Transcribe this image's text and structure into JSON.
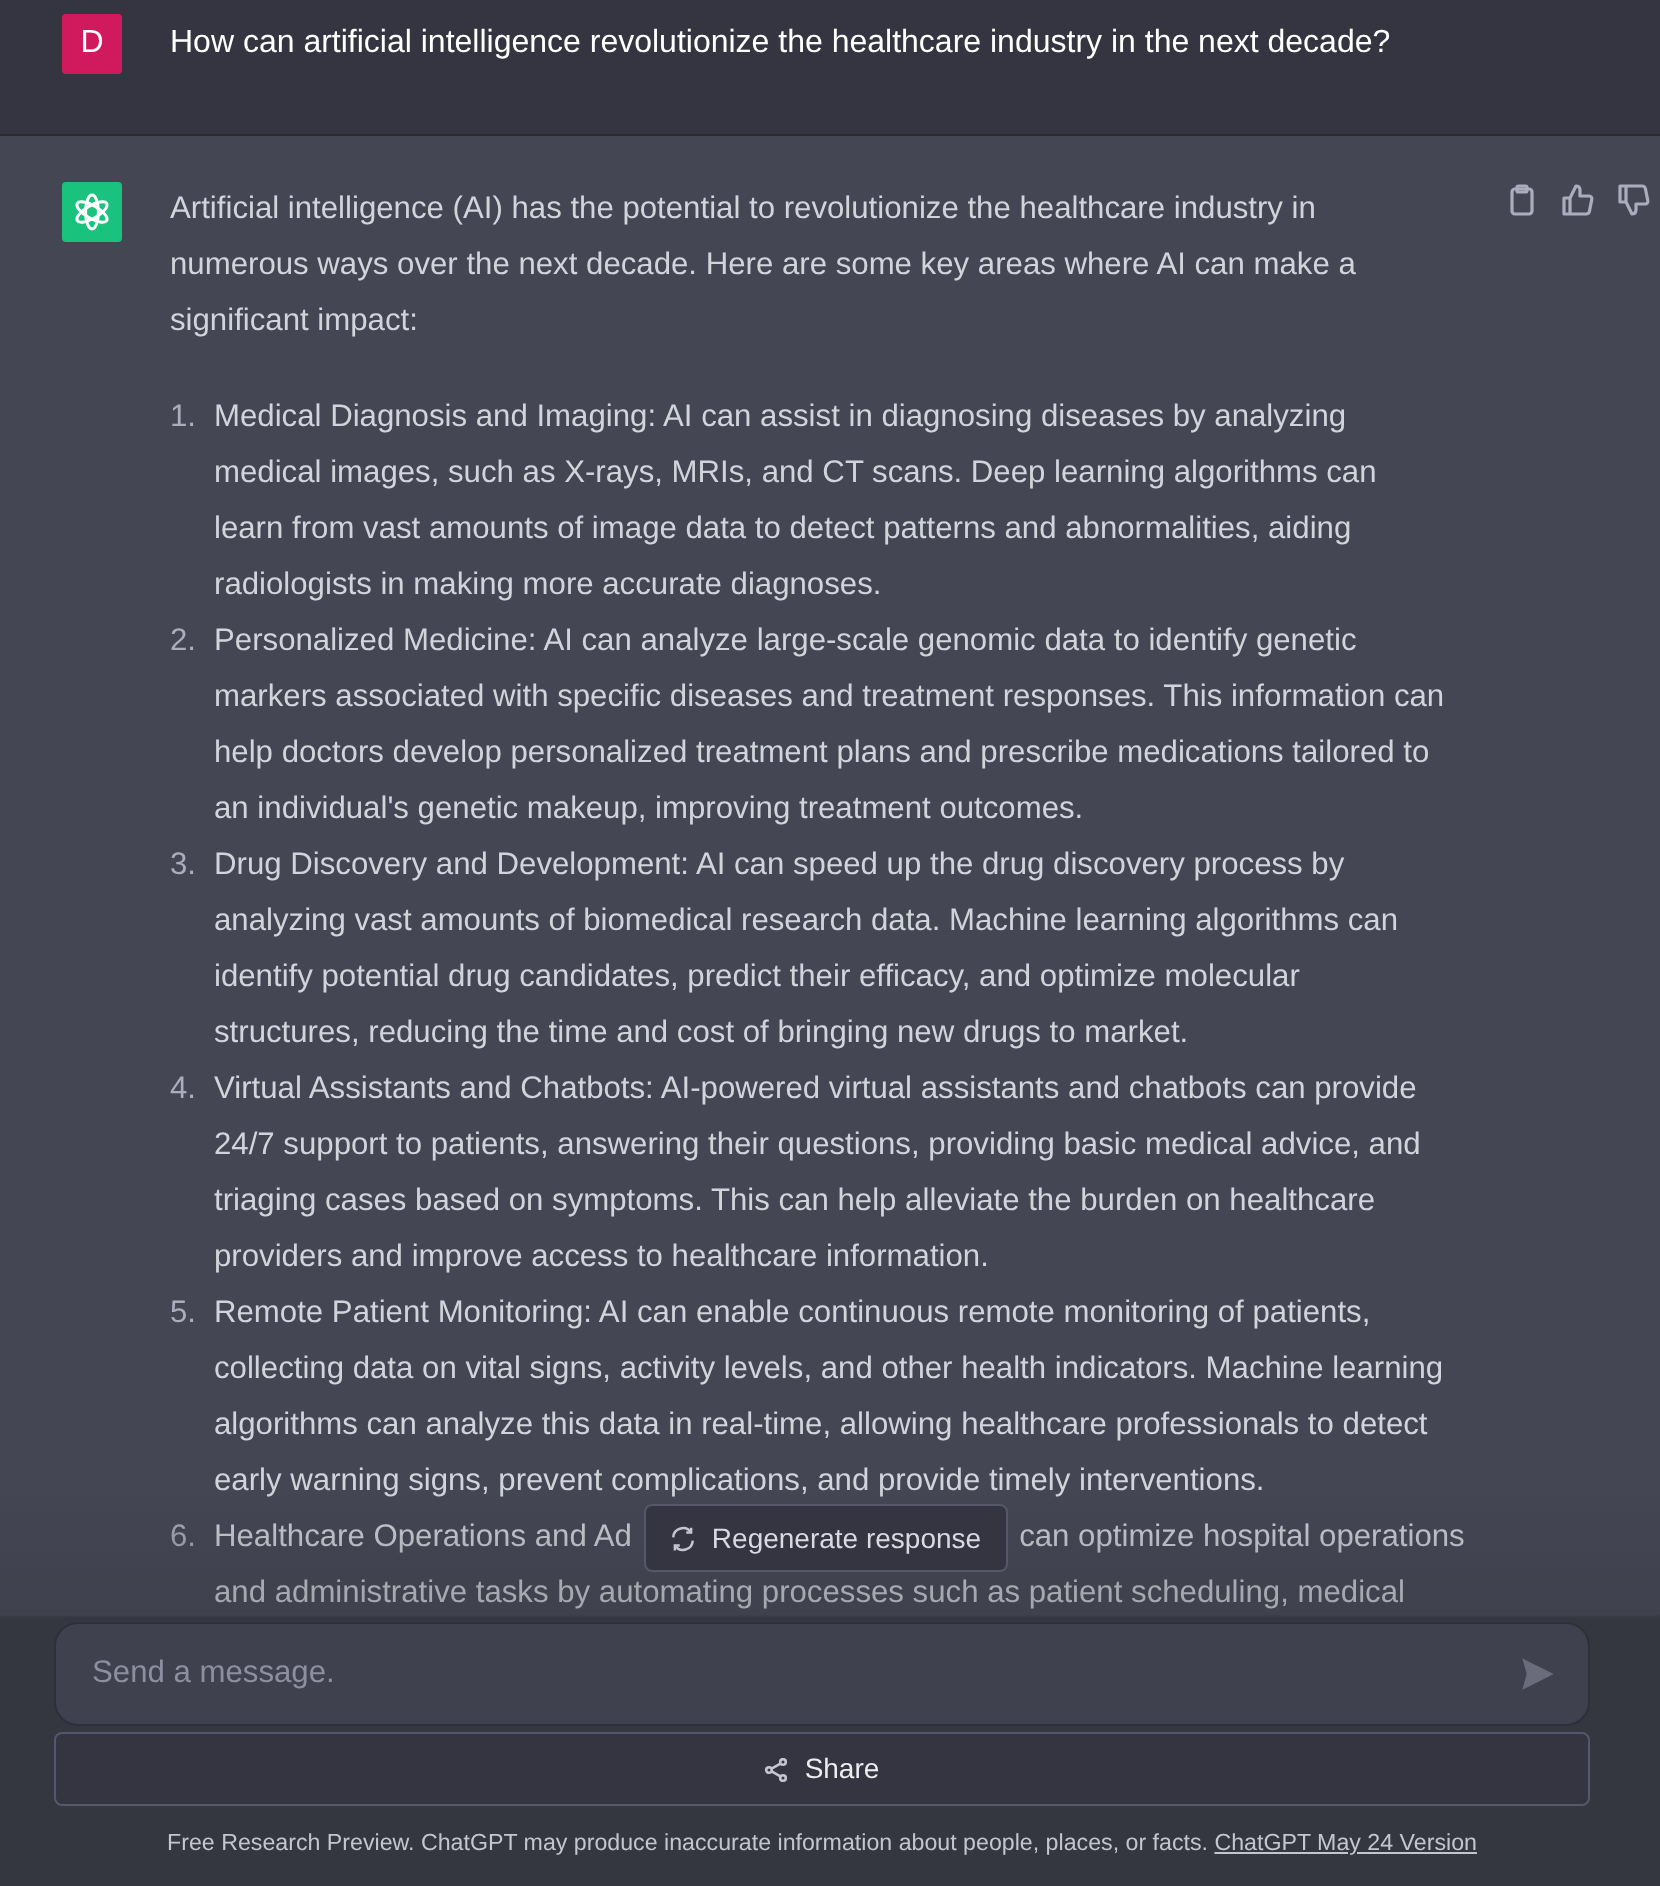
{
  "user_message": {
    "avatar_letter": "D",
    "text": "How can artificial intelligence revolutionize the healthcare industry in the next decade?"
  },
  "assistant_message": {
    "intro": "Artificial intelligence (AI) has the potential to revolutionize the healthcare industry in numerous ways over the next decade. Here are some key areas where AI can make a significant impact:",
    "items": [
      {
        "number": "1.",
        "text": "Medical Diagnosis and Imaging: AI can assist in diagnosing diseases by analyzing medical images, such as X-rays, MRIs, and CT scans. Deep learning algorithms can learn from vast amounts of image data to detect patterns and abnormalities, aiding radiologists in making more accurate diagnoses."
      },
      {
        "number": "2.",
        "text": "Personalized Medicine: AI can analyze large-scale genomic data to identify genetic markers associated with specific diseases and treatment responses. This information can help doctors develop personalized treatment plans and prescribe medications tailored to an individual's genetic makeup, improving treatment outcomes."
      },
      {
        "number": "3.",
        "text": "Drug Discovery and Development: AI can speed up the drug discovery process by analyzing vast amounts of biomedical research data. Machine learning algorithms can identify potential drug candidates, predict their efficacy, and optimize molecular structures, reducing the time and cost of bringing new drugs to market."
      },
      {
        "number": "4.",
        "text": "Virtual Assistants and Chatbots: AI-powered virtual assistants and chatbots can provide 24/7 support to patients, answering their questions, providing basic medical advice, and triaging cases based on symptoms. This can help alleviate the burden on healthcare providers and improve access to healthcare information."
      },
      {
        "number": "5.",
        "text": "Remote Patient Monitoring: AI can enable continuous remote monitoring of patients, collecting data on vital signs, activity levels, and other health indicators. Machine learning algorithms can analyze this data in real-time, allowing healthcare professionals to detect early warning signs, prevent complications, and provide timely interventions."
      }
    ],
    "partial_item": {
      "number": "6.",
      "line_parts": [
        "Healthcare Operations and Ad",
        "can optimize hospital operations"
      ],
      "next_line": "and administrative tasks by automating processes such as patient scheduling, medical"
    }
  },
  "regenerate_button": {
    "label": "Regenerate response"
  },
  "composer": {
    "placeholder": "Send a message."
  },
  "share_button": {
    "label": "Share"
  },
  "footer": {
    "text": "Free Research Preview. ChatGPT may produce inaccurate information about people, places, or facts.",
    "link": "ChatGPT May 24 Version"
  }
}
